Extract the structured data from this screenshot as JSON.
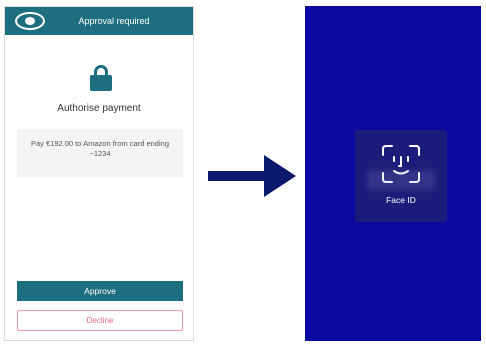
{
  "phone": {
    "header_title": "Approval required",
    "auth_title": "Authorise payment",
    "payment_line1": "Pay €192.00 to Amazon from card ending",
    "payment_line2": "~1234",
    "approve_label": "Approve",
    "decline_label": "Decline"
  },
  "faceid": {
    "label": "Face ID"
  },
  "icons": {
    "logo": "bank-logo-icon",
    "lock": "lock-icon",
    "arrow": "arrow-right-icon",
    "faceid": "face-id-icon"
  },
  "colors": {
    "brand_teal": "#1d6f7f",
    "decline_pink": "#e06a87",
    "screen_blue": "#0a0aa2",
    "arrow_navy": "#0b1a6e"
  }
}
